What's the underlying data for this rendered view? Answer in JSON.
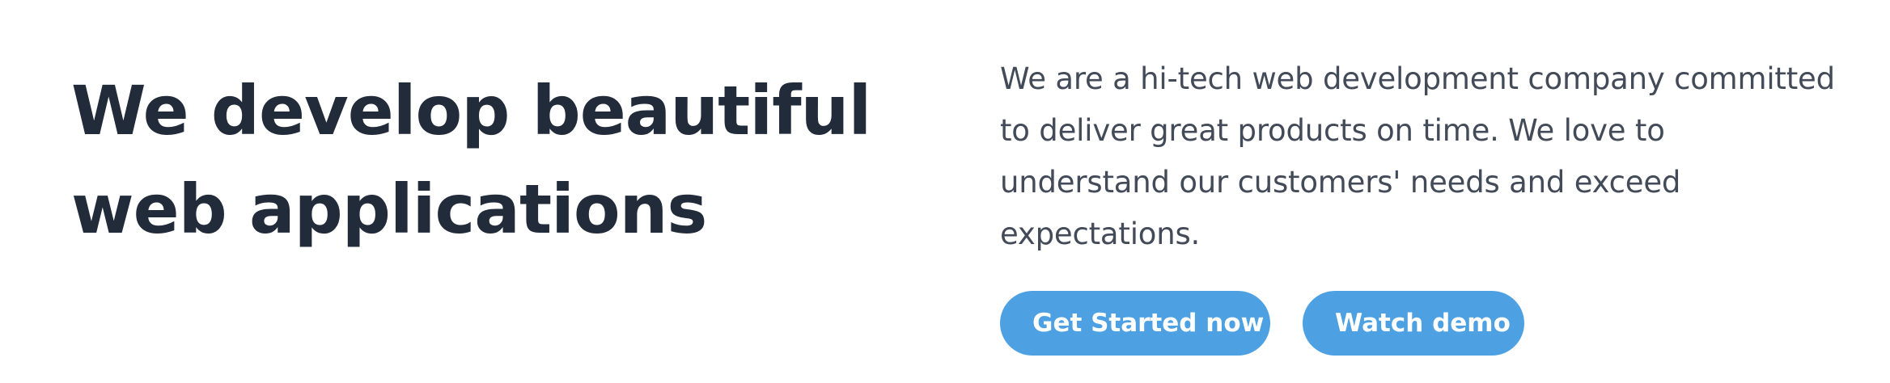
{
  "hero": {
    "title_line_1": "We develop beautiful",
    "title_line_2": "web applications",
    "description": "We are a hi-tech web development company committed to deliver great products on time. We love to understand our customers' needs and exceed expectations.",
    "primary_button": "Get Started now",
    "secondary_button": "Watch demo"
  },
  "colors": {
    "heading": "#222b3a",
    "body_text": "#434a58",
    "button": "#4da1e3",
    "button_text": "#ffffff",
    "background": "#ffffff"
  }
}
